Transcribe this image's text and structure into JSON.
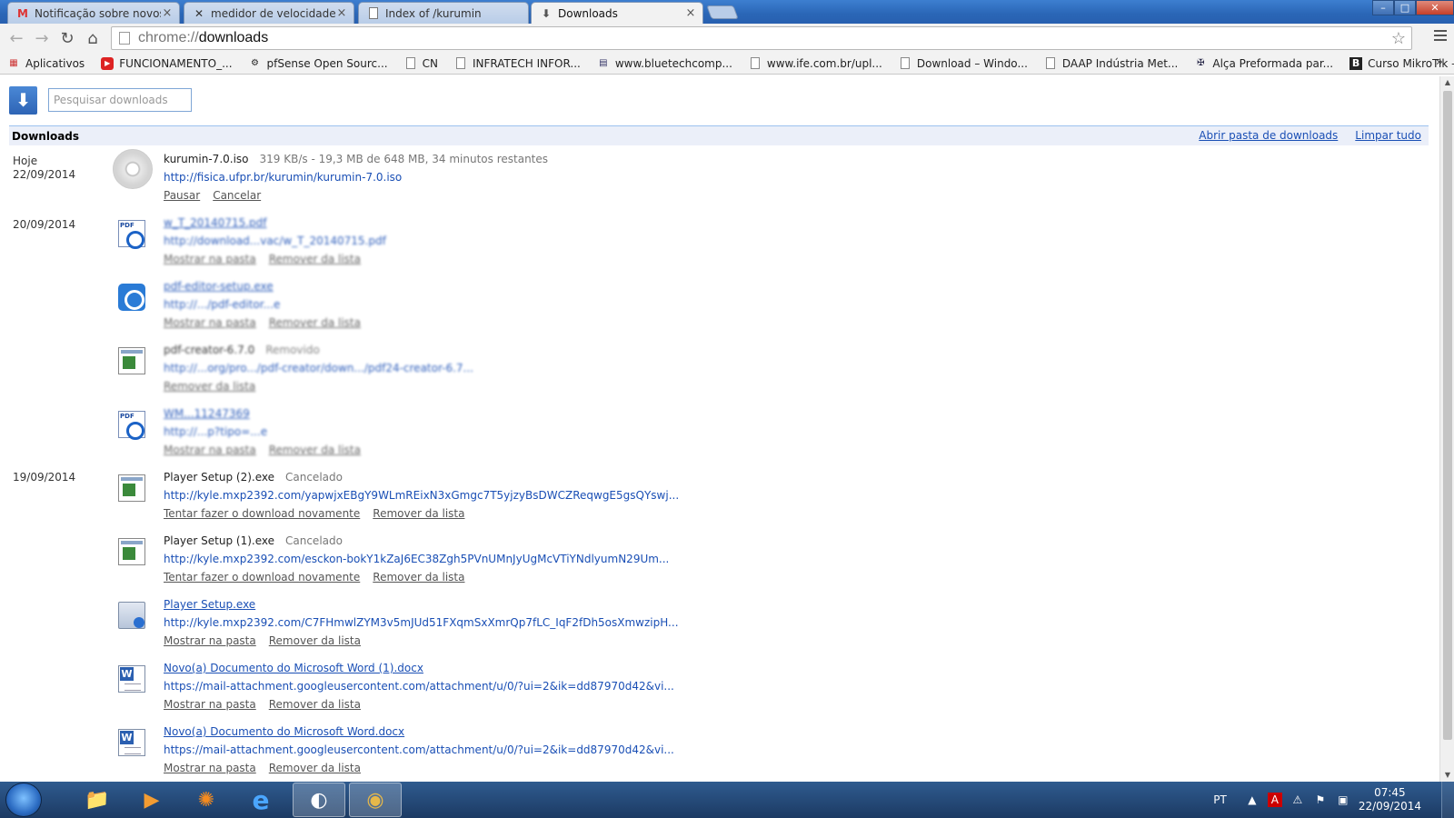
{
  "browser": {
    "tabs": [
      {
        "title": "Notificação sobre novos t",
        "icon": "gmail-icon",
        "active": false
      },
      {
        "title": "medidor de velocidade id",
        "icon": "x-icon",
        "active": false
      },
      {
        "title": "Index of /kurumin",
        "icon": "page-icon",
        "active": false
      },
      {
        "title": "Downloads",
        "icon": "download-icon",
        "active": true
      }
    ],
    "tab_close_glyph": "×",
    "window_controls": {
      "minimize": "–",
      "maximize": "□",
      "close": "✕"
    },
    "address": {
      "scheme": "chrome://",
      "path": "downloads"
    },
    "bookmarks": [
      {
        "label": "Aplicativos",
        "icon": "apps-grid-icon"
      },
      {
        "label": "FUNCIONAMENTO_...",
        "icon": "youtube-icon"
      },
      {
        "label": "pfSense Open Sourc...",
        "icon": "pfsense-icon"
      },
      {
        "label": "CN",
        "icon": "page-icon"
      },
      {
        "label": "INFRATECH INFOR...",
        "icon": "page-icon"
      },
      {
        "label": "www.bluetechcomp...",
        "icon": "bluetech-icon"
      },
      {
        "label": "www.ife.com.br/upl...",
        "icon": "page-icon"
      },
      {
        "label": "Download – Windo...",
        "icon": "page-icon"
      },
      {
        "label": "DAAP Indústria Met...",
        "icon": "page-icon"
      },
      {
        "label": "Alça Preformada par...",
        "icon": "preformed-icon"
      },
      {
        "label": "Curso MikroTik – M...",
        "icon": "b-icon"
      }
    ],
    "bookmarks_more": "»"
  },
  "downloads": {
    "search_placeholder": "Pesquisar downloads",
    "section_title": "Downloads",
    "open_folder_link": "Abrir pasta de downloads",
    "clear_all_link": "Limpar tudo",
    "days": [
      {
        "label": "Hoje",
        "date": "22/09/2014"
      },
      {
        "label": "",
        "date": "20/09/2014"
      },
      {
        "label": "",
        "date": "19/09/2014"
      }
    ],
    "items": [
      {
        "icon": "disc-icon",
        "name": "kurumin-7.0.iso",
        "name_is_link": false,
        "status": "319 KB/s - 19,3 MB de 648 MB, 34 minutos restantes",
        "url": "http://fisica.ufpr.br/kurumin/kurumin-7.0.iso",
        "actions": [
          "Pausar",
          "Cancelar"
        ],
        "obscured": false
      },
      {
        "icon": "pdf-icon",
        "name": "w_T_20140715.pdf",
        "name_is_link": true,
        "status": "",
        "url": "http://download...vac/w_T_20140715.pdf",
        "actions": [
          "Mostrar na pasta",
          "Remover da lista"
        ],
        "obscured": true
      },
      {
        "icon": "pdf-editor-app-icon",
        "name": "pdf-editor-setup.exe",
        "name_is_link": true,
        "status": "",
        "url": "http://.../pdf-editor...e",
        "actions": [
          "Mostrar na pasta",
          "Remover da lista"
        ],
        "obscured": true
      },
      {
        "icon": "exe-icon",
        "name": "pdf-creator-6.7.0",
        "name_is_link": false,
        "status": "Removido",
        "url": "http://...org/pro.../pdf-creator/down.../pdf24-creator-6.7...",
        "actions": [
          "Remover da lista"
        ],
        "obscured": true
      },
      {
        "icon": "pdf-icon",
        "name": "WM...11247369",
        "name_is_link": true,
        "status": "",
        "url": "http://...p?tipo=...e",
        "actions": [
          "Mostrar na pasta",
          "Remover da lista"
        ],
        "obscured": true
      },
      {
        "icon": "exe-icon",
        "name": "Player Setup (2).exe",
        "name_is_link": false,
        "status": "Cancelado",
        "url": "http://kyle.mxp2392.com/yapwjxEBgY9WLmREixN3xGmgc7T5yjzyBsDWCZReqwgE5gsQYswj...",
        "actions": [
          "Tentar fazer o download novamente",
          "Remover da lista"
        ],
        "obscured": false
      },
      {
        "icon": "exe-icon",
        "name": "Player Setup (1).exe",
        "name_is_link": false,
        "status": "Cancelado",
        "url": "http://kyle.mxp2392.com/esckon-bokY1kZaJ6EC38Zgh5PVnUMnJyUgMcVTiYNdlyumN29Um...",
        "actions": [
          "Tentar fazer o download novamente",
          "Remover da lista"
        ],
        "obscured": false
      },
      {
        "icon": "setup-icon",
        "name": "Player Setup.exe",
        "name_is_link": true,
        "status": "",
        "url": "http://kyle.mxp2392.com/C7FHmwlZYM3v5mJUd51FXqmSxXmrQp7fLC_IqF2fDh5osXmwzipH...",
        "actions": [
          "Mostrar na pasta",
          "Remover da lista"
        ],
        "obscured": false
      },
      {
        "icon": "word-icon",
        "name": "Novo(a) Documento do Microsoft Word (1).docx",
        "name_is_link": true,
        "status": "",
        "url": "https://mail-attachment.googleusercontent.com/attachment/u/0/?ui=2&ik=dd87970d42&vi...",
        "actions": [
          "Mostrar na pasta",
          "Remover da lista"
        ],
        "obscured": false
      },
      {
        "icon": "word-icon",
        "name": "Novo(a) Documento do Microsoft Word.docx",
        "name_is_link": true,
        "status": "",
        "url": "https://mail-attachment.googleusercontent.com/attachment/u/0/?ui=2&ik=dd87970d42&vi...",
        "actions": [
          "Mostrar na pasta",
          "Remover da lista"
        ],
        "obscured": false
      }
    ]
  },
  "taskbar": {
    "apps": [
      {
        "name": "explorer-icon",
        "glyph": "📁",
        "active": false
      },
      {
        "name": "media-player-icon",
        "glyph": "▶",
        "active": false
      },
      {
        "name": "avast-icon",
        "glyph": "✺",
        "active": false
      },
      {
        "name": "internet-explorer-icon",
        "glyph": "e",
        "active": false
      },
      {
        "name": "skype-like-icon",
        "glyph": "◐",
        "active": true
      },
      {
        "name": "chrome-icon",
        "glyph": "◉",
        "active": true
      }
    ],
    "language": "PT",
    "time": "07:45",
    "date": "22/09/2014"
  },
  "colors": {
    "link": "#1a4fb5",
    "accent": "#2e64b5",
    "taskbar": "#1c3a63"
  }
}
